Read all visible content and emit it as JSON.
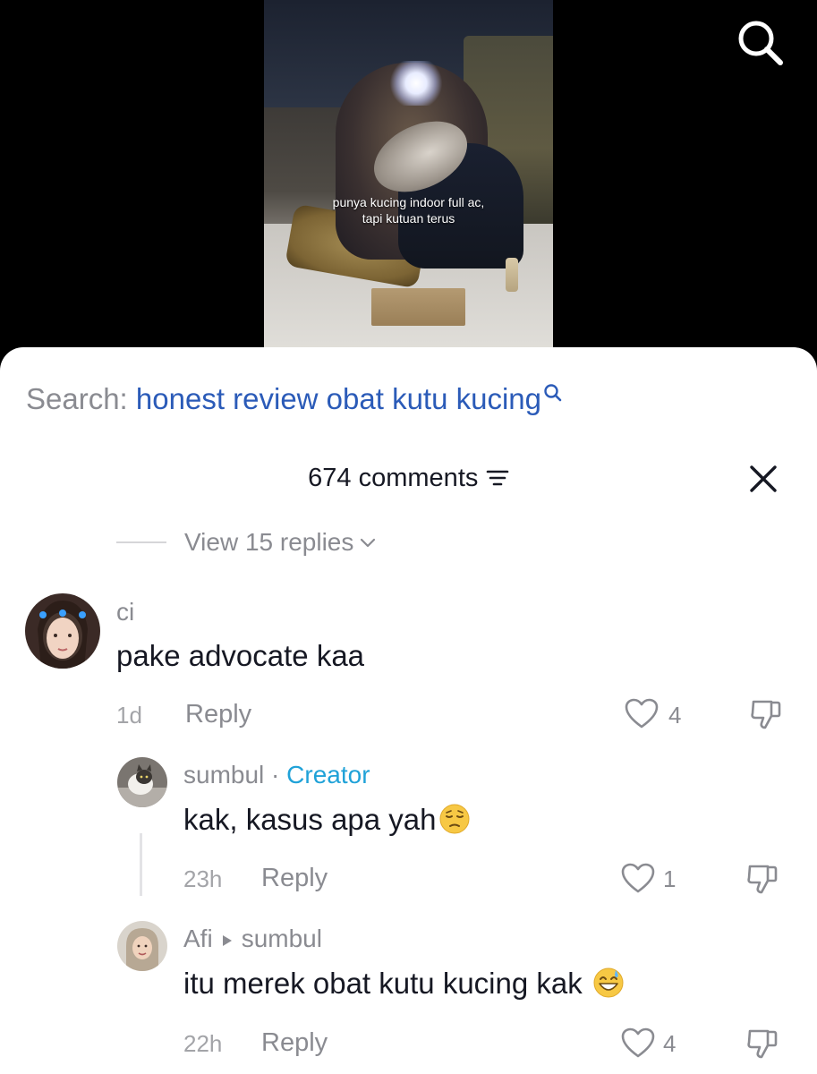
{
  "video": {
    "caption_line1": "punya kucing indoor full ac,",
    "caption_line2": "tapi kutuan terus"
  },
  "search": {
    "label": "Search:",
    "query": "honest review obat kutu kucing"
  },
  "comments_panel": {
    "title": "674 comments"
  },
  "view_replies": {
    "label": "View 15 replies"
  },
  "comments": [
    {
      "author": "ci",
      "text": "pake advocate kaa",
      "time": "1d",
      "reply_label": "Reply",
      "likes": "4"
    },
    {
      "author": "sumbul",
      "separator": "·",
      "tag": "Creator",
      "text": "kak, kasus apa yah",
      "emoji": "pensive-face",
      "time": "23h",
      "reply_label": "Reply",
      "likes": "1"
    },
    {
      "author": "Afi",
      "reply_to": "sumbul",
      "text": "itu merek obat kutu kucing kak",
      "emoji": "grinning-sweat-face",
      "time": "22h",
      "reply_label": "Reply",
      "likes": "4"
    }
  ],
  "colors": {
    "search_query": "#2b5bb8",
    "creator_tag": "#20a2d8",
    "muted": "#8a8b91",
    "text": "#161823"
  }
}
